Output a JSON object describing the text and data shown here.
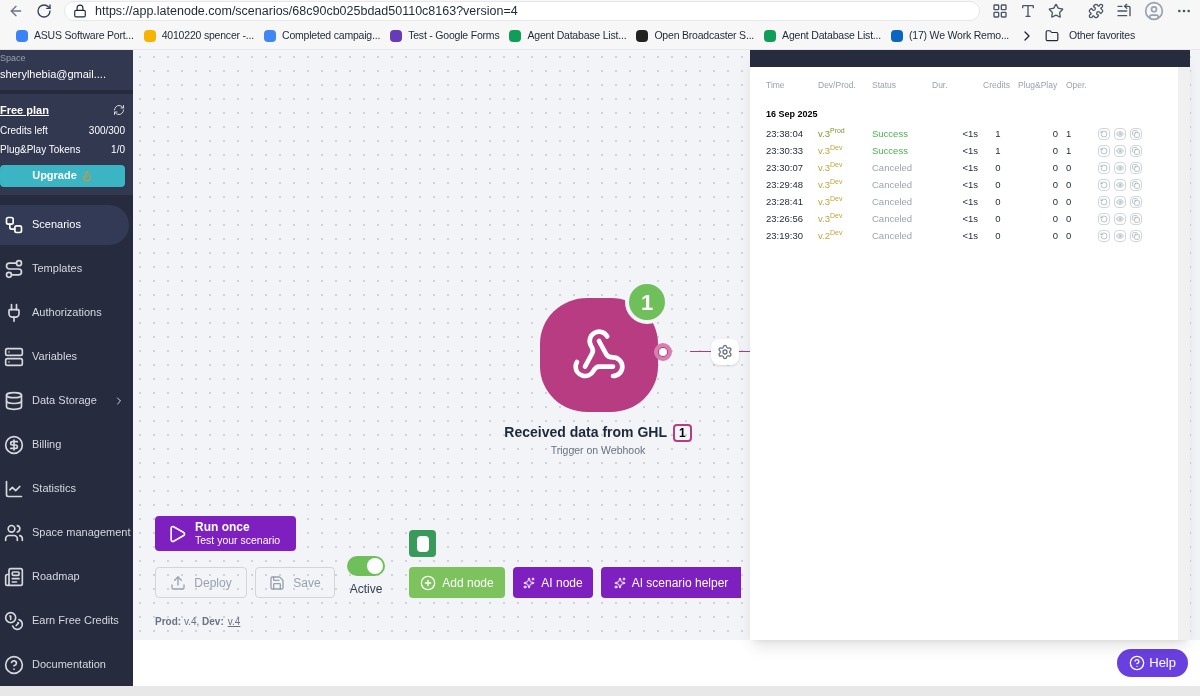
{
  "browser": {
    "url": "https://app.latenode.com/scenarios/68c90cb025bdad50110c8163?version=4",
    "bookmarks": [
      {
        "label": "ASUS Software Port...",
        "color": "#3b82f6"
      },
      {
        "label": "4010220 spencer -...",
        "color": "#f4b400"
      },
      {
        "label": "Completed campaig...",
        "color": "#4285f4"
      },
      {
        "label": "Test - Google Forms",
        "color": "#673ab7"
      },
      {
        "label": "Agent Database List...",
        "color": "#0f9d58"
      },
      {
        "label": "Open Broadcaster S...",
        "color": "#222222"
      },
      {
        "label": "Agent Database List...",
        "color": "#0f9d58"
      },
      {
        "label": "(17) We Work Remo...",
        "color": "#0a66c2"
      }
    ],
    "other_favorites": "Other favorites"
  },
  "sidebar": {
    "space_label": "Space",
    "email": "sherylhebia@gmail....",
    "plan": "Free plan",
    "stats": [
      {
        "label": "Credits left",
        "value": "300/300"
      },
      {
        "label": "Plug&Play Tokens",
        "value": "1/0"
      }
    ],
    "upgrade": "Upgrade",
    "items": [
      {
        "label": "Scenarios",
        "selected": true,
        "kind": "scenarios"
      },
      {
        "label": "Templates",
        "selected": false,
        "kind": "templates"
      },
      {
        "label": "Authorizations",
        "selected": false,
        "kind": "auth"
      },
      {
        "label": "Variables",
        "selected": false,
        "kind": "variables"
      },
      {
        "label": "Data Storage",
        "selected": false,
        "kind": "storage",
        "submenu": true
      },
      {
        "label": "Billing",
        "selected": false,
        "kind": "billing"
      },
      {
        "label": "Statistics",
        "selected": false,
        "kind": "stats"
      },
      {
        "label": "Space management",
        "selected": false,
        "kind": "space"
      },
      {
        "label": "Roadmap",
        "selected": false,
        "kind": "roadmap"
      },
      {
        "label": "Earn Free Credits",
        "selected": false,
        "kind": "credits"
      },
      {
        "label": "Documentation",
        "selected": false,
        "kind": "docs"
      }
    ]
  },
  "node": {
    "run_count": "1",
    "title": "Received data from GHL",
    "count": "1",
    "subtitle": "Trigger on Webhook"
  },
  "controls": {
    "run_title": "Run once",
    "run_subtitle": "Test your scenario",
    "deploy": {
      "label": "Deploy",
      "disabled": true
    },
    "save": {
      "label": "Save",
      "disabled": true
    },
    "active": {
      "label": "Active",
      "on": true
    },
    "add_node": "Add node",
    "ai_node": "AI node",
    "ai_helper": "AI scenario helper",
    "versions": "**Prod:** v.4, **Dev:**",
    "dev_link": "v.4"
  },
  "log": {
    "columns": [
      "Time",
      "Dev/Prod.",
      "Status",
      "Dur.",
      "Credits",
      "Plug&Play",
      "Oper."
    ],
    "date": "16 Sep 2025",
    "rows": [
      {
        "time": "23:38:04",
        "version": "v.3",
        "env": "Prod",
        "status": "Success",
        "kind": "success",
        "dur": "<1s",
        "credits": "1",
        "plug": "0",
        "oper": "1"
      },
      {
        "time": "23:30:33",
        "version": "v.3",
        "env": "Dev",
        "status": "Success",
        "kind": "success",
        "dur": "<1s",
        "credits": "1",
        "plug": "0",
        "oper": "1"
      },
      {
        "time": "23:30:07",
        "version": "v.3",
        "env": "Dev",
        "status": "Canceled",
        "kind": "canceled",
        "dur": "<1s",
        "credits": "0",
        "plug": "0",
        "oper": "0"
      },
      {
        "time": "23:29:48",
        "version": "v.3",
        "env": "Dev",
        "status": "Canceled",
        "kind": "canceled",
        "dur": "<1s",
        "credits": "0",
        "plug": "0",
        "oper": "0"
      },
      {
        "time": "23:28:41",
        "version": "v.3",
        "env": "Dev",
        "status": "Canceled",
        "kind": "canceled",
        "dur": "<1s",
        "credits": "0",
        "plug": "0",
        "oper": "0"
      },
      {
        "time": "23:26:56",
        "version": "v.3",
        "env": "Dev",
        "status": "Canceled",
        "kind": "canceled",
        "dur": "<1s",
        "credits": "0",
        "plug": "0",
        "oper": "0"
      },
      {
        "time": "23:19:30",
        "version": "v.2",
        "env": "Dev",
        "status": "Canceled",
        "kind": "canceled",
        "dur": "<1s",
        "credits": "0",
        "plug": "0",
        "oper": "0"
      }
    ]
  },
  "help": "Help"
}
